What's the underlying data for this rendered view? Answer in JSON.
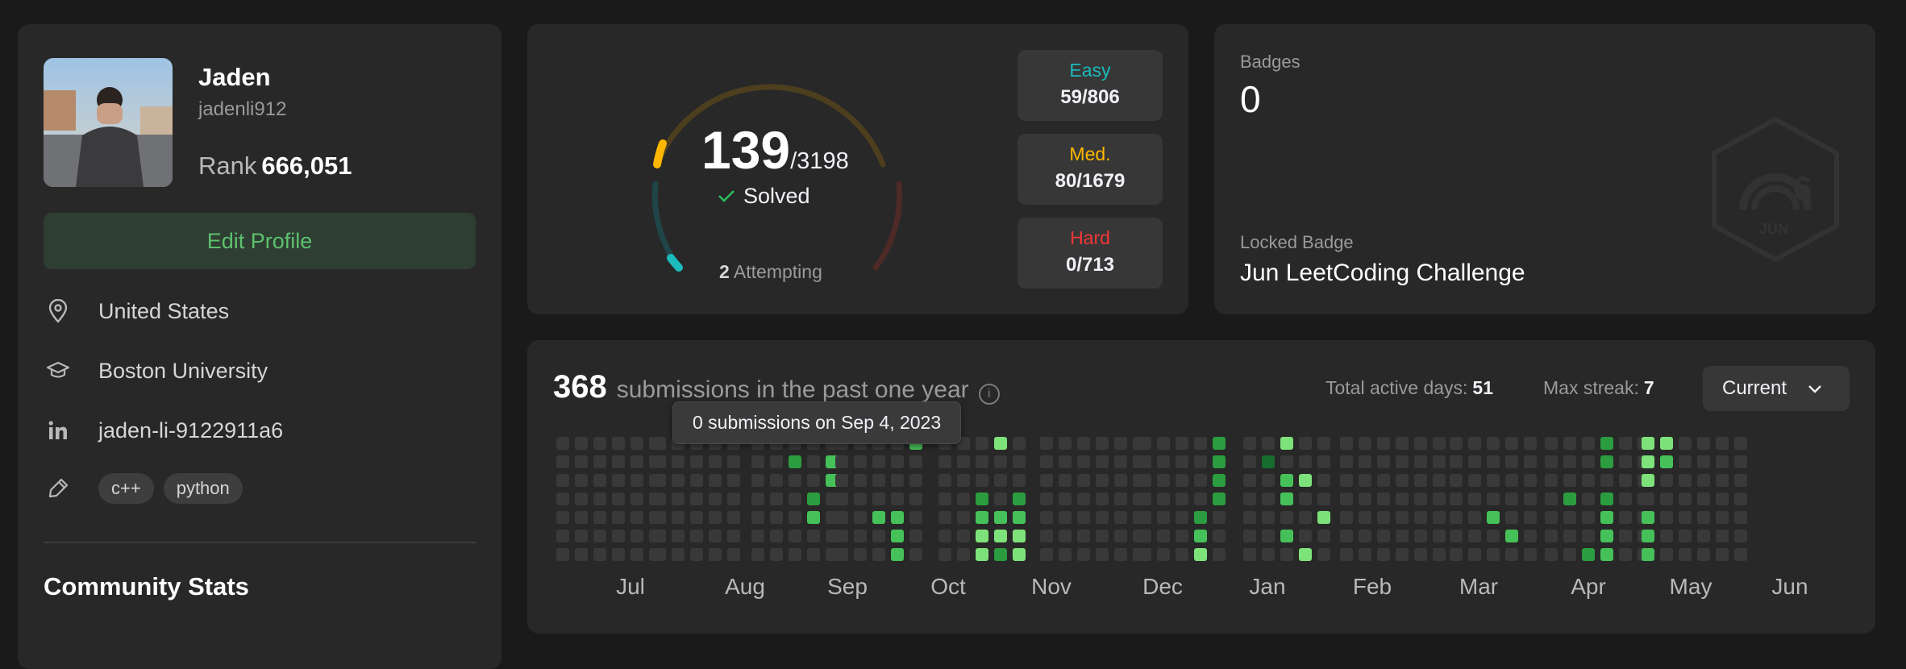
{
  "profile": {
    "name": "Jaden",
    "username": "jadenli912",
    "rank_label": "Rank",
    "rank_value": "666,051",
    "edit_label": "Edit Profile",
    "location": "United States",
    "school": "Boston University",
    "linkedin": "jaden-li-9122911a6",
    "skills": [
      "c++",
      "python"
    ],
    "community_title": "Community Stats"
  },
  "solved": {
    "count": "139",
    "total": "/3198",
    "solved_label": "Solved",
    "attempting_count": "2",
    "attempting_label": "Attempting",
    "easy_label": "Easy",
    "easy_value": "59/806",
    "easy_color": "#1cbaba",
    "medium_label": "Med.",
    "medium_value": "80/1679",
    "medium_color": "#ffb700",
    "hard_label": "Hard",
    "hard_value": "0/713",
    "hard_color": "#f63737"
  },
  "badges": {
    "label": "Badges",
    "count": "0",
    "locked_label": "Locked Badge",
    "locked_name": "Jun LeetCoding Challenge",
    "badge_icon_text": "JUN",
    "badge_icon_number": "6"
  },
  "heatmap": {
    "count": "368",
    "subtitle": "submissions in the past one year",
    "active_label": "Total active days:",
    "active_value": "51",
    "streak_label": "Max streak:",
    "streak_value": "7",
    "period": "Current",
    "tooltip": "0 submissions on Sep 4, 2023",
    "months": [
      "Jul",
      "Aug",
      "Sep",
      "Oct",
      "Nov",
      "Dec",
      "Jan",
      "Feb",
      "Mar",
      "Apr",
      "May",
      "Jun"
    ],
    "colors": {
      "empty": "#393939",
      "l1": "#166d2e",
      "l2": "#2b9c3f",
      "l3": "#46c15a",
      "l4": "#7ee27b"
    }
  }
}
